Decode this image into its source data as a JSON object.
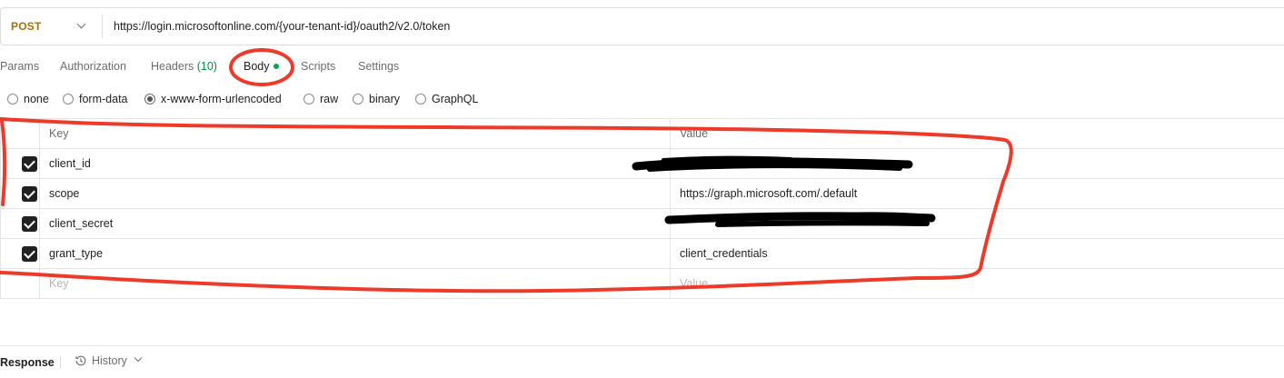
{
  "request": {
    "method": "POST",
    "url": "https://login.microsoftonline.com/{your-tenant-id}/oauth2/v2.0/token"
  },
  "tabs": [
    {
      "label": "Params"
    },
    {
      "label": "Authorization"
    },
    {
      "label": "Headers",
      "count": "(10)"
    },
    {
      "label": "Body"
    },
    {
      "label": "Scripts"
    },
    {
      "label": "Settings"
    }
  ],
  "body_types": [
    {
      "label": "none",
      "checked": false
    },
    {
      "label": "form-data",
      "checked": false
    },
    {
      "label": "x-www-form-urlencoded",
      "checked": true
    },
    {
      "label": "raw",
      "checked": false
    },
    {
      "label": "binary",
      "checked": false
    },
    {
      "label": "GraphQL",
      "checked": false
    }
  ],
  "table": {
    "key_header": "Key",
    "value_header": "Value",
    "rows": [
      {
        "key": "client_id",
        "value": "",
        "checked": true,
        "redacted": true
      },
      {
        "key": "scope",
        "value": "https://graph.microsoft.com/.default",
        "checked": true,
        "redacted": false
      },
      {
        "key": "client_secret",
        "value": "",
        "checked": true,
        "redacted": true
      },
      {
        "key": "grant_type",
        "value": "client_credentials",
        "checked": true,
        "redacted": false
      }
    ],
    "key_placeholder": "Key",
    "value_placeholder": "Value"
  },
  "response": {
    "label": "Response",
    "history_label": "History"
  },
  "colors": {
    "method": "#a86f00",
    "annotation": "#ee3a2b",
    "redaction": "#000000",
    "body_dot": "#0aa34f",
    "headers_count": "#0a8a3f"
  },
  "icons": [
    "chevron-down-icon",
    "clock-icon",
    "checkbox-checked-icon",
    "radio-icon"
  ]
}
